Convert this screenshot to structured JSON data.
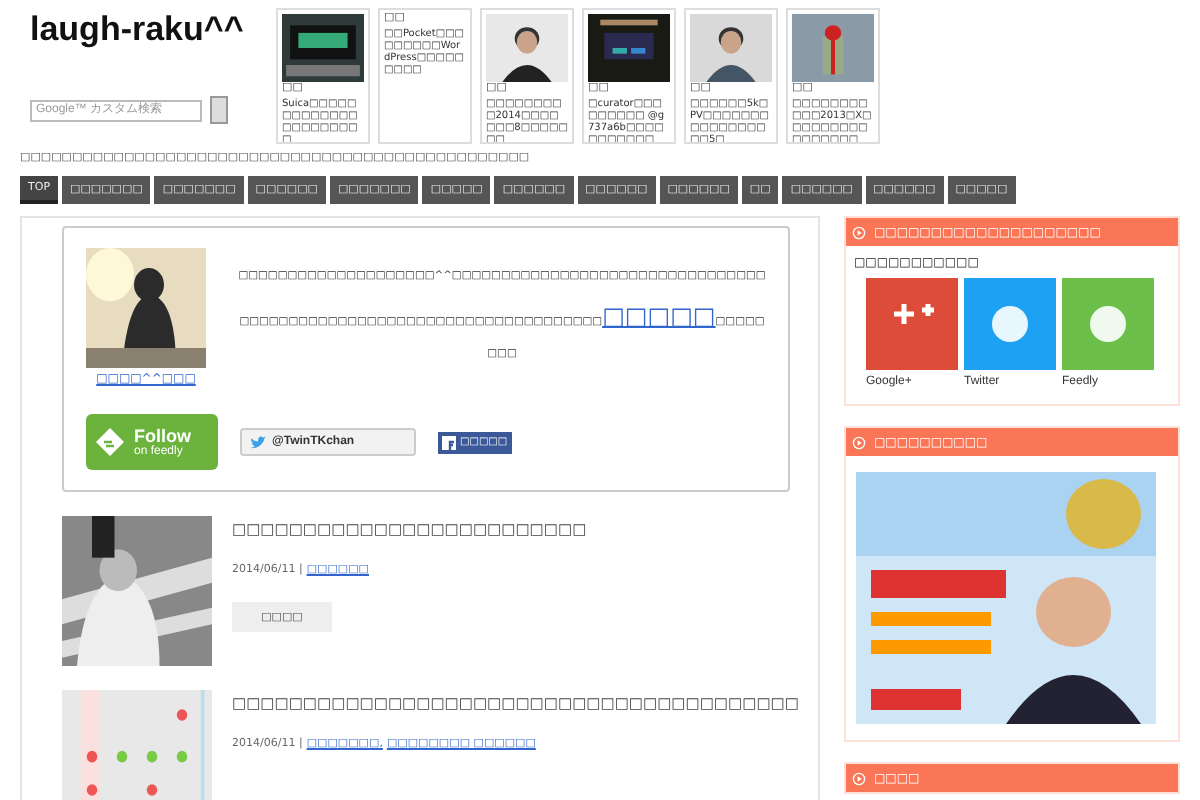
{
  "site_title": "laugh-raku^^",
  "search": {
    "placeholder": "Google™ カスタム検索"
  },
  "featured": [
    {
      "title": "□□",
      "caption": "Suica□□□□□□□□□□□□□□□□□□□□□□",
      "kind": "picture"
    },
    {
      "title": "□□",
      "caption": "□□Pocket□□□□□□□□□WordPress□□□□□□□□□",
      "kind": "text"
    },
    {
      "title": "□□",
      "caption": "□□□□□□□□□2014□□□□□□□8□□□□□□□",
      "kind": "picture"
    },
    {
      "title": "□□",
      "caption": "□curator□□□□□□□□□ @g737a6b□□□□□□□□□□□",
      "kind": "picture"
    },
    {
      "title": "□□",
      "caption": "□□□□□□5k□PV□□□□□□□□□□□□□□□□□5□",
      "kind": "picture"
    },
    {
      "title": "□□",
      "caption": "□□□□□□□□□□□2013□X□□□□□□□□□□□□□□□□",
      "kind": "picture"
    }
  ],
  "tagline": "□□□□□□□□□□□□□□□□□□□□□□□□□□□□□□□□□□□□□□□□□□□□□□□□□",
  "nav": [
    {
      "label": "TOP",
      "selected": true
    },
    {
      "label": "□□□□□□□",
      "selected": false
    },
    {
      "label": "□□□□□□□",
      "selected": false
    },
    {
      "label": "□□□□□□",
      "selected": false
    },
    {
      "label": "□□□□□□□",
      "selected": false
    },
    {
      "label": "□□□□□",
      "selected": false
    },
    {
      "label": "□□□□□□",
      "selected": false
    },
    {
      "label": "□□□□□□",
      "selected": false
    },
    {
      "label": "□□□□□□",
      "selected": false
    },
    {
      "label": "□□",
      "selected": false
    },
    {
      "label": "□□□□□□",
      "selected": false
    },
    {
      "label": "□□□□□□",
      "selected": false
    },
    {
      "label": "□□□□□",
      "selected": false
    }
  ],
  "profile": {
    "name": "□□□□^^□□□",
    "text": "□□□□□□□□□□□□□□□□□□□□^^□□□□□□□□□□□□□□□□□□□□□□□□□□□□□□□□□□□□□□□□□□□□□□□□□□□□□□□□□□□□□□□□□□□□□",
    "link": "□□□□□",
    "text_after": "□□□□□□□□",
    "feedly_follow": "Follow",
    "feedly_sub": "on feedly",
    "twitter": "@TwinTKchan",
    "facebook": "□□□□□"
  },
  "posts": [
    {
      "title": "□□□□□□□□□□□□□□□□□□□□□□□□□",
      "date": "2014/06/11 |",
      "categories": [
        "□□□□□□"
      ],
      "button": "□□□□"
    },
    {
      "title": "□□□□□□□□□□□□□□□□□□□□□□□□□□□□□□□□□□□□□□□□",
      "date": "2014/06/11 |",
      "categories": [
        "□□□□□□□,",
        "□□□□□□□□ □□□□□□"
      ],
      "kind": "table"
    }
  ],
  "sidebar": [
    {
      "title": "□□□□□□□□□□□□□□□□□□□□",
      "kind": "follow",
      "subtitle": "□□□□□□□□□□□",
      "services": [
        {
          "label": "Google+",
          "color": "#dd4b39"
        },
        {
          "label": "Twitter",
          "color": "#1da1f2"
        },
        {
          "label": "Feedly",
          "color": "#6cc04a"
        }
      ]
    },
    {
      "title": "□□□□□□□□□□",
      "kind": "ad"
    },
    {
      "title": "□□□□",
      "kind": "empty"
    }
  ]
}
